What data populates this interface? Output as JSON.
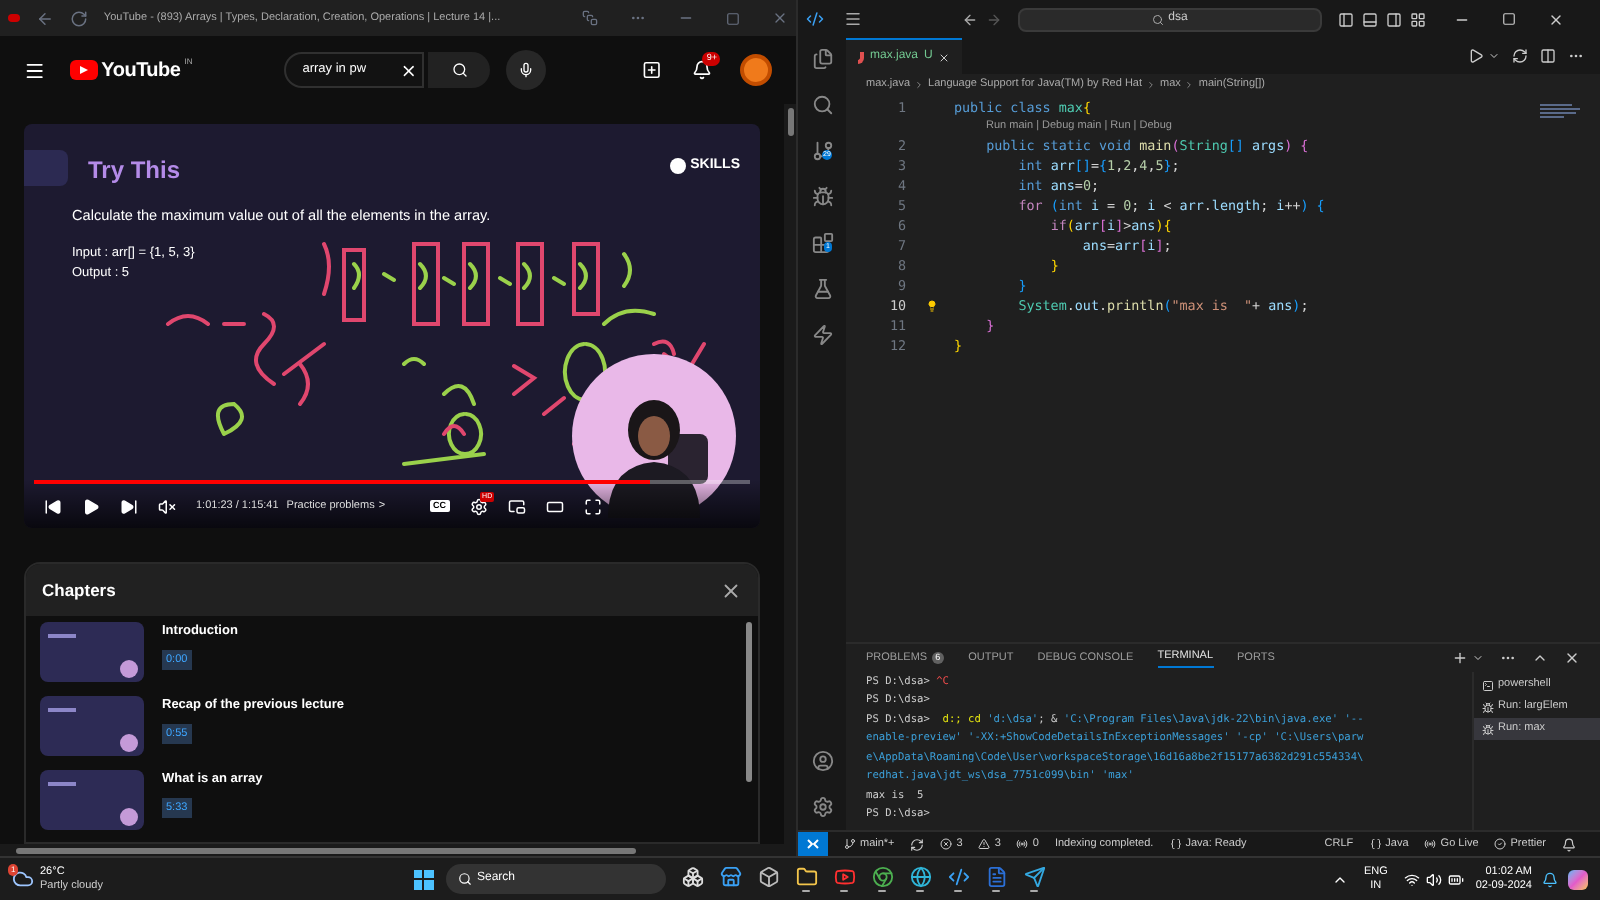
{
  "browser": {
    "title": "YouTube - (893) Arrays | Types, Declaration, Creation, Operations | Lecture 14 |...",
    "youtube": {
      "logo": "YouTube",
      "region": "IN",
      "search_value": "array in pw",
      "notifications": "9+"
    },
    "video": {
      "slide_title": "Try This",
      "brand": "SKILLS",
      "task": "Calculate the maximum value out of all the elements in the array.",
      "input": "Input : arr[] = {1, 5, 3}",
      "output": "Output : 5",
      "level": 0.86,
      "time": "1:01:23 / 1:15:41",
      "chapter": "Practice problems",
      "chapter_arrow": ">",
      "cc": "CC",
      "quality": "HD"
    },
    "chapters": {
      "title": "Chapters",
      "items": [
        {
          "title": "Introduction",
          "time": "0:00"
        },
        {
          "title": "Recap of the previous lecture",
          "time": "0:55"
        },
        {
          "title": "What is an array",
          "time": "5:33"
        }
      ]
    }
  },
  "vscode": {
    "search": "dsa",
    "scm_badge": "29",
    "extensions_badge": "1",
    "tab": {
      "label": "max.java",
      "status": "U"
    },
    "breadcrumb": [
      "max.java",
      "Language Support for Java(TM) by Red Hat",
      "max",
      "main(String[])"
    ],
    "codelens": "Run main | Debug main | Run | Debug",
    "lines": [
      {
        "number": "1",
        "current": false,
        "tokens": [
          {
            "kind": "keyword",
            "text": "public class "
          },
          {
            "kind": "type",
            "text": "max"
          },
          {
            "kind": "b1",
            "text": "{"
          }
        ]
      },
      {
        "number": "2",
        "current": false,
        "tokens": [
          {
            "kind": "keyword",
            "text": "public static void "
          },
          {
            "kind": "method",
            "text": "main"
          },
          {
            "kind": "b2",
            "text": "("
          },
          {
            "kind": "type",
            "text": "String"
          },
          {
            "kind": "b3",
            "text": "[]"
          },
          {
            "kind": "var",
            "text": " args"
          },
          {
            "kind": "b2",
            "text": ") {"
          }
        ]
      },
      {
        "number": "3",
        "current": false,
        "tokens": [
          {
            "kind": "keyword",
            "text": "int "
          },
          {
            "kind": "var",
            "text": "arr"
          },
          {
            "kind": "b3",
            "text": "[]"
          },
          {
            "kind": "plain",
            "text": "="
          },
          {
            "kind": "b3",
            "text": "{"
          },
          {
            "kind": "number",
            "text": "1"
          },
          {
            "kind": "plain",
            "text": ","
          },
          {
            "kind": "number",
            "text": "2"
          },
          {
            "kind": "plain",
            "text": ","
          },
          {
            "kind": "number",
            "text": "4"
          },
          {
            "kind": "plain",
            "text": ","
          },
          {
            "kind": "number",
            "text": "5"
          },
          {
            "kind": "b3",
            "text": "}"
          },
          {
            "kind": "plain",
            "text": ";"
          }
        ]
      },
      {
        "number": "4",
        "current": false,
        "tokens": [
          {
            "kind": "keyword",
            "text": "int "
          },
          {
            "kind": "var",
            "text": "ans"
          },
          {
            "kind": "plain",
            "text": "="
          },
          {
            "kind": "number",
            "text": "0"
          },
          {
            "kind": "plain",
            "text": ";"
          }
        ]
      },
      {
        "number": "5",
        "current": false,
        "tokens": [
          {
            "kind": "control",
            "text": "for "
          },
          {
            "kind": "b3",
            "text": "("
          },
          {
            "kind": "keyword",
            "text": "int "
          },
          {
            "kind": "var",
            "text": "i"
          },
          {
            "kind": "plain",
            "text": " = "
          },
          {
            "kind": "number",
            "text": "0"
          },
          {
            "kind": "plain",
            "text": "; "
          },
          {
            "kind": "var",
            "text": "i"
          },
          {
            "kind": "plain",
            "text": " < "
          },
          {
            "kind": "var",
            "text": "arr"
          },
          {
            "kind": "plain",
            "text": "."
          },
          {
            "kind": "var",
            "text": "length"
          },
          {
            "kind": "plain",
            "text": "; "
          },
          {
            "kind": "var",
            "text": "i"
          },
          {
            "kind": "plain",
            "text": "++"
          },
          {
            "kind": "b3",
            "text": ") {"
          }
        ]
      },
      {
        "number": "6",
        "current": false,
        "tokens": [
          {
            "kind": "control",
            "text": "if"
          },
          {
            "kind": "b1",
            "text": "("
          },
          {
            "kind": "var",
            "text": "arr"
          },
          {
            "kind": "b2",
            "text": "["
          },
          {
            "kind": "var",
            "text": "i"
          },
          {
            "kind": "b2",
            "text": "]"
          },
          {
            "kind": "plain",
            "text": ">"
          },
          {
            "kind": "var",
            "text": "ans"
          },
          {
            "kind": "b1",
            "text": ")"
          },
          {
            "kind": "b1",
            "text": "{"
          }
        ]
      },
      {
        "number": "7",
        "current": false,
        "tokens": [
          {
            "kind": "var",
            "text": "ans"
          },
          {
            "kind": "plain",
            "text": "="
          },
          {
            "kind": "var",
            "text": "arr"
          },
          {
            "kind": "b2",
            "text": "["
          },
          {
            "kind": "var",
            "text": "i"
          },
          {
            "kind": "b2",
            "text": "]"
          },
          {
            "kind": "plain",
            "text": ";"
          }
        ]
      },
      {
        "number": "8",
        "current": false,
        "tokens": [
          {
            "kind": "b1",
            "text": "}"
          }
        ]
      },
      {
        "number": "9",
        "current": false,
        "tokens": [
          {
            "kind": "b3",
            "text": "}"
          }
        ]
      },
      {
        "number": "10",
        "current": true,
        "tokens": [
          {
            "kind": "type",
            "text": "System"
          },
          {
            "kind": "plain",
            "text": "."
          },
          {
            "kind": "var",
            "text": "out"
          },
          {
            "kind": "plain",
            "text": "."
          },
          {
            "kind": "method",
            "text": "println"
          },
          {
            "kind": "b3",
            "text": "("
          },
          {
            "kind": "string",
            "text": "\"max is  \""
          },
          {
            "kind": "plain",
            "text": "+ "
          },
          {
            "kind": "var",
            "text": "ans"
          },
          {
            "kind": "b3",
            "text": ")"
          },
          {
            "kind": "plain",
            "text": ";"
          }
        ]
      },
      {
        "number": "11",
        "current": false,
        "tokens": [
          {
            "kind": "b2",
            "text": "}"
          }
        ]
      },
      {
        "number": "12",
        "current": false,
        "tokens": [
          {
            "kind": "b1",
            "text": "}"
          }
        ]
      }
    ],
    "panel": {
      "tabs": [
        {
          "label": "PROBLEMS",
          "badge": "6",
          "selected": false
        },
        {
          "label": "OUTPUT",
          "selected": false
        },
        {
          "label": "DEBUG CONSOLE",
          "selected": false
        },
        {
          "label": "TERMINAL",
          "selected": true
        },
        {
          "label": "PORTS",
          "selected": false
        }
      ],
      "terminal": [
        [
          {
            "kind": "plain",
            "text": "PS D:\\dsa> "
          },
          {
            "kind": "error",
            "text": "^C"
          }
        ],
        [
          {
            "kind": "plain",
            "text": "PS D:\\dsa>"
          }
        ],
        [
          {
            "kind": "plain",
            "text": "PS D:\\dsa>  "
          },
          {
            "kind": "command",
            "text": "d:; cd"
          },
          {
            "kind": "string",
            "text": " 'd:\\dsa'"
          },
          {
            "kind": "plain",
            "text": "; & "
          },
          {
            "kind": "string",
            "text": "'C:\\Program Files\\Java\\jdk-22\\bin\\java.exe' '--"
          }
        ],
        [
          {
            "kind": "string",
            "text": "enable-preview' '-XX:+ShowCodeDetailsInExceptionMessages' '-cp' 'C:\\Users\\parw"
          }
        ],
        [
          {
            "kind": "string",
            "text": "e\\AppData\\Roaming\\Code\\User\\workspaceStorage\\16d16a8be2f15177a6382d291c554334\\"
          }
        ],
        [
          {
            "kind": "string",
            "text": "redhat.java\\jdt_ws\\dsa_7751c099\\bin' 'max'"
          }
        ],
        [
          {
            "kind": "plain",
            "text": "max is  5"
          }
        ],
        [
          {
            "kind": "plain",
            "text": "PS D:\\dsa>"
          }
        ]
      ],
      "sessions": [
        {
          "kind": "shell",
          "label": "powershell",
          "selected": false
        },
        {
          "kind": "run",
          "label": "Run: largElem",
          "selected": false
        },
        {
          "kind": "run",
          "label": "Run: max",
          "selected": true
        }
      ]
    },
    "status_left": [
      {
        "kind": "branch",
        "text": "main*+"
      },
      {
        "kind": "sync"
      },
      {
        "kind": "errors",
        "text": "3"
      },
      {
        "kind": "warnings",
        "text": "3"
      },
      {
        "kind": "ports",
        "text": "0"
      },
      {
        "kind": "plain",
        "text": "Indexing completed."
      },
      {
        "kind": "java",
        "text": "Java: Ready"
      }
    ],
    "status_right": [
      {
        "kind": "plain",
        "text": "CRLF"
      },
      {
        "kind": "braces",
        "text": "Java"
      },
      {
        "kind": "live",
        "text": "Go Live"
      },
      {
        "kind": "check",
        "text": "Prettier"
      },
      {
        "kind": "bell"
      }
    ]
  },
  "taskbar": {
    "temperature": "26°C",
    "weather": "Partly cloudy",
    "weather_badge": "1",
    "search": "Search",
    "apps": [
      {
        "kind": "taskview",
        "active": false
      },
      {
        "kind": "store",
        "active": false
      },
      {
        "kind": "cube",
        "active": false
      },
      {
        "kind": "folder",
        "active": true
      },
      {
        "kind": "youtube",
        "active": true
      },
      {
        "kind": "chrome",
        "active": true
      },
      {
        "kind": "edge",
        "active": true
      },
      {
        "kind": "vscode",
        "active": true
      },
      {
        "kind": "word",
        "active": true
      },
      {
        "kind": "telegram",
        "active": true
      }
    ],
    "language": "ENG",
    "region": "IN",
    "time": "01:02 AM",
    "date": "02-09-2024"
  }
}
